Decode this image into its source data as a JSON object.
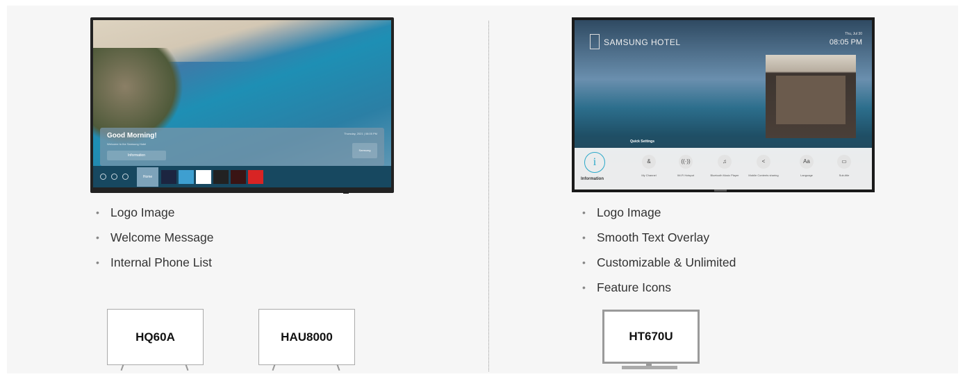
{
  "left": {
    "tv": {
      "greeting": "Good Morning!",
      "subtext": "Welcome to the Samsung Hotel",
      "info_button": "Information",
      "date_text": "Thursday, 2021 | 08:05 PM",
      "right_button": "Samsung",
      "home_label": "Home"
    },
    "bullets": [
      "Logo Image",
      "Welcome Message",
      "Internal Phone List"
    ],
    "models": [
      "HQ60A",
      "HAU8000"
    ]
  },
  "right": {
    "tv": {
      "hotel_name": "SAMSUNG HOTEL",
      "date": "Thu, Jul 30",
      "time": "08:05 PM",
      "quick_settings_label": "Quick Settings",
      "info_label": "Information",
      "quick_items": [
        {
          "icon": "person-icon",
          "glyph": "&",
          "label": "My Channel"
        },
        {
          "icon": "wifi-hotspot-icon",
          "glyph": "((·))",
          "label": "Wi-Fi Hotspot"
        },
        {
          "icon": "music-icon",
          "glyph": "♫",
          "label": "Bluetooth Music Player"
        },
        {
          "icon": "share-icon",
          "glyph": "<",
          "label": "Mobile Contents sharing"
        },
        {
          "icon": "language-icon",
          "glyph": "Aa",
          "label": "Language"
        },
        {
          "icon": "subtitle-icon",
          "glyph": "▭",
          "label": "Sub-title"
        }
      ]
    },
    "bullets": [
      "Logo Image",
      "Smooth Text Overlay",
      "Customizable & Unlimited",
      "Feature Icons"
    ],
    "model": "HT670U"
  },
  "colors": {
    "accent": "#29a8c9",
    "panel_bg": "#f6f6f6",
    "bar_bg": "#174860"
  }
}
